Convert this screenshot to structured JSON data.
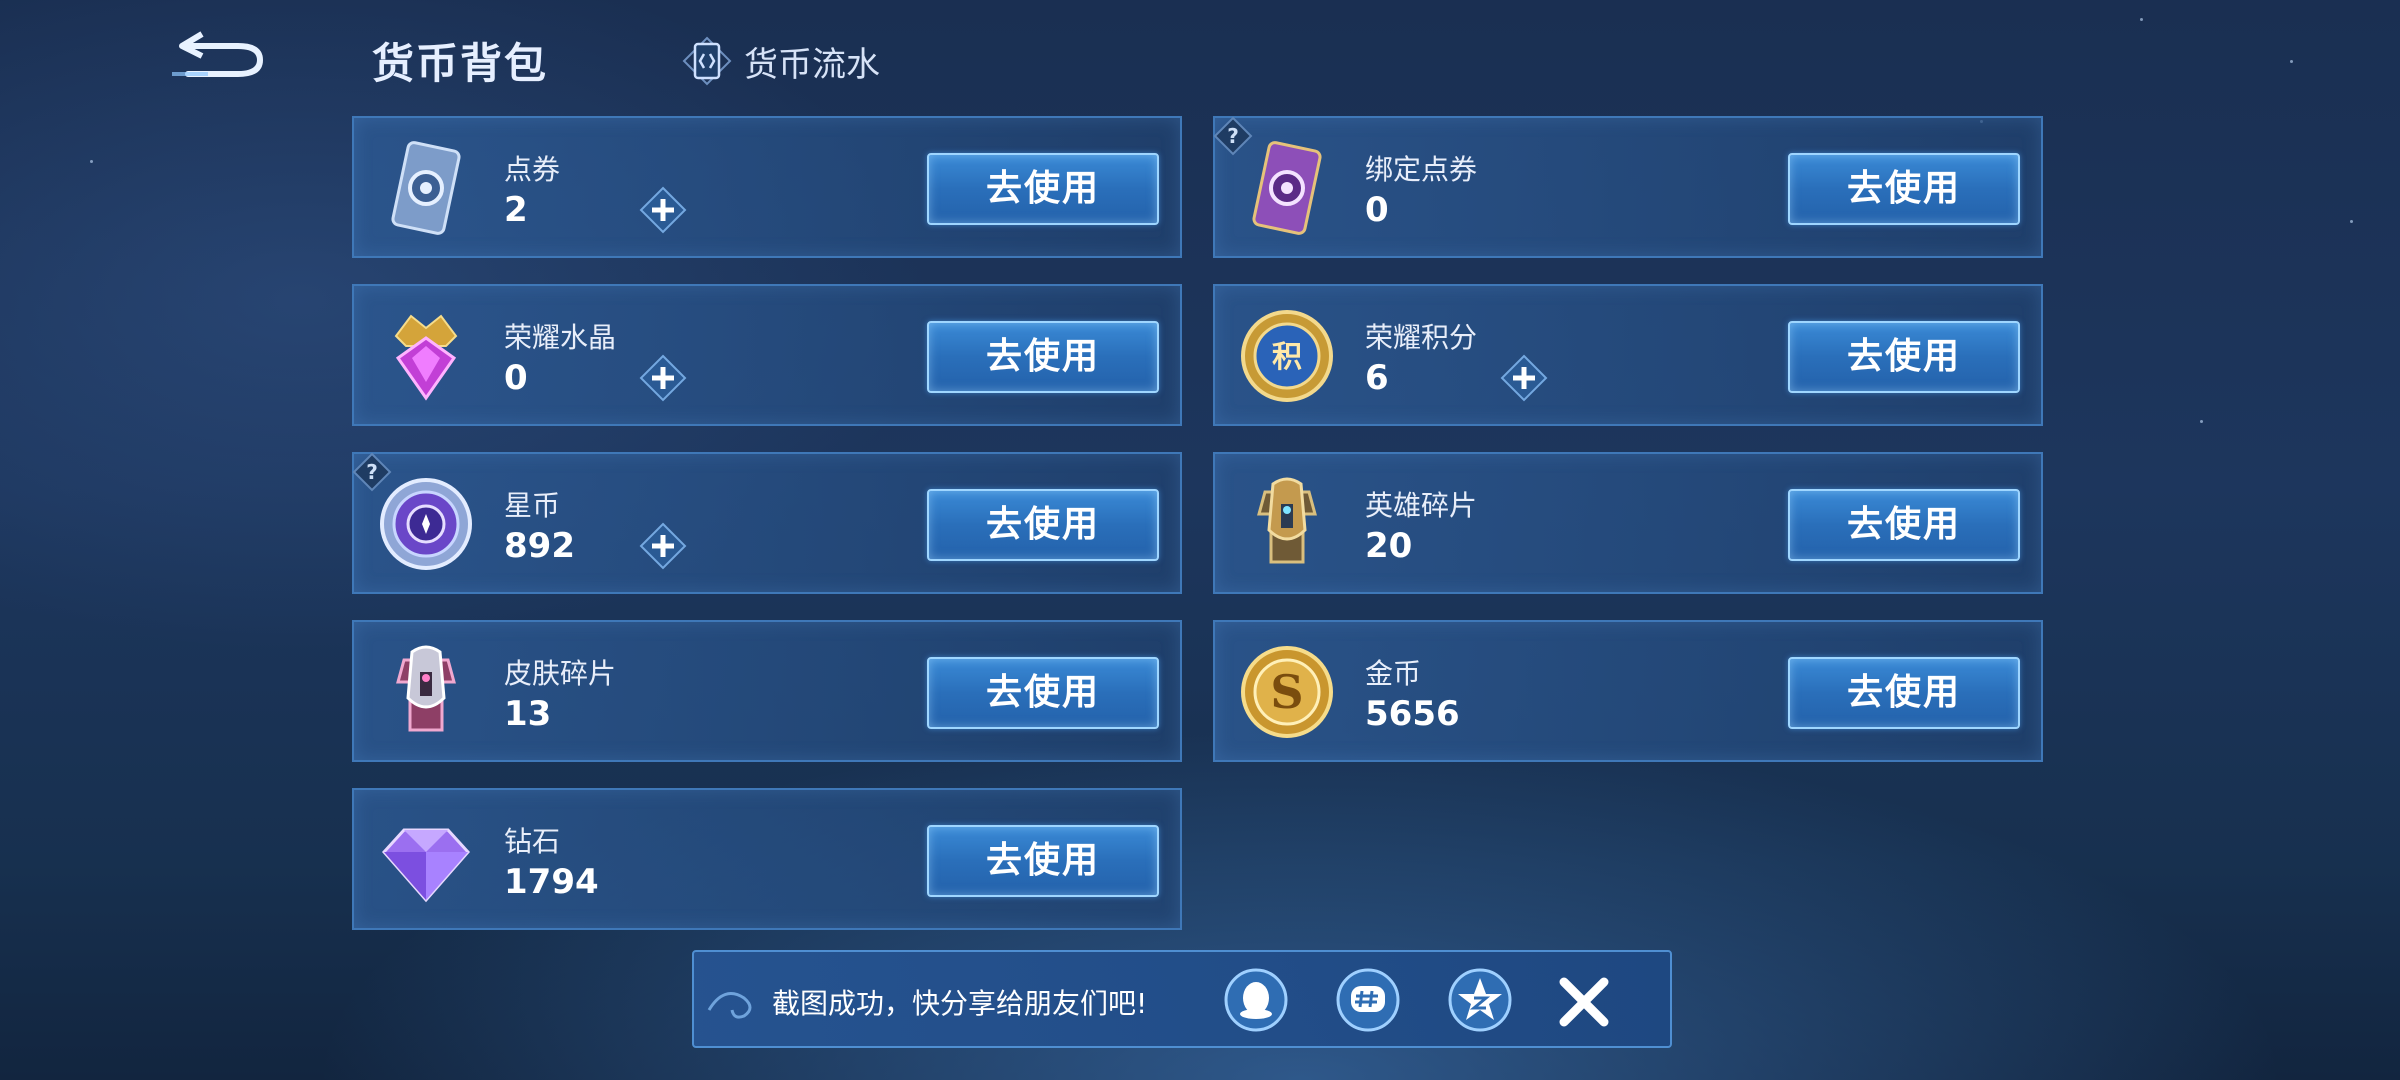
{
  "header": {
    "title": "货币背包",
    "flow_tab": "货币流水"
  },
  "currencies": [
    {
      "name": "点券",
      "value": "2",
      "button": "去使用"
    },
    {
      "name": "绑定点券",
      "value": "0",
      "button": "去使用"
    },
    {
      "name": "荣耀水晶",
      "value": "0",
      "button": "去使用"
    },
    {
      "name": "荣耀积分",
      "value": "6",
      "button": "去使用"
    },
    {
      "name": "星币",
      "value": "892",
      "button": "去使用"
    },
    {
      "name": "英雄碎片",
      "value": "20",
      "button": "去使用"
    },
    {
      "name": "皮肤碎片",
      "value": "13",
      "button": "去使用"
    },
    {
      "name": "金币",
      "value": "5656",
      "button": "去使用"
    },
    {
      "name": "钻石",
      "value": "1794",
      "button": "去使用"
    }
  ],
  "share": {
    "message": "截图成功，快分享给朋友们吧!",
    "targets": [
      "qq-icon",
      "wechat-moments-icon",
      "qzone-icon"
    ],
    "close": "close-icon"
  },
  "colors": {
    "card_border": "#3f78b8",
    "button_fill": "#2a6fba",
    "button_border": "#9fd6ff"
  }
}
